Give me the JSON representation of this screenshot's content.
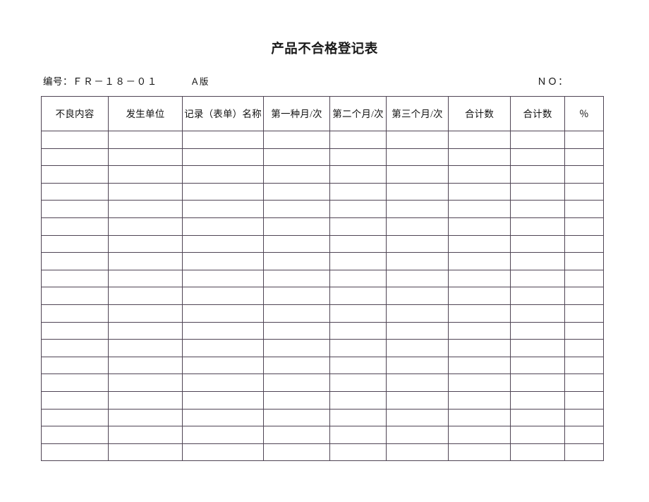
{
  "document": {
    "title": "产品不合格登记表",
    "meta": {
      "code_label": "编号：",
      "code_value": "ＦＲ－１８－０１",
      "edition": "Ａ版",
      "no_label": "ＮＯ："
    }
  },
  "table": {
    "headers": [
      "不良内容",
      "发生单位",
      "记录（表单）名称",
      "第一种月/次",
      "第二个月/次",
      "第三个月/次",
      "合计数",
      "合计数",
      "％"
    ],
    "row_count": 19,
    "rows": [
      [
        "",
        "",
        "",
        "",
        "",
        "",
        "",
        "",
        ""
      ],
      [
        "",
        "",
        "",
        "",
        "",
        "",
        "",
        "",
        ""
      ],
      [
        "",
        "",
        "",
        "",
        "",
        "",
        "",
        "",
        ""
      ],
      [
        "",
        "",
        "",
        "",
        "",
        "",
        "",
        "",
        ""
      ],
      [
        "",
        "",
        "",
        "",
        "",
        "",
        "",
        "",
        ""
      ],
      [
        "",
        "",
        "",
        "",
        "",
        "",
        "",
        "",
        ""
      ],
      [
        "",
        "",
        "",
        "",
        "",
        "",
        "",
        "",
        ""
      ],
      [
        "",
        "",
        "",
        "",
        "",
        "",
        "",
        "",
        ""
      ],
      [
        "",
        "",
        "",
        "",
        "",
        "",
        "",
        "",
        ""
      ],
      [
        "",
        "",
        "",
        "",
        "",
        "",
        "",
        "",
        ""
      ],
      [
        "",
        "",
        "",
        "",
        "",
        "",
        "",
        "",
        ""
      ],
      [
        "",
        "",
        "",
        "",
        "",
        "",
        "",
        "",
        ""
      ],
      [
        "",
        "",
        "",
        "",
        "",
        "",
        "",
        "",
        ""
      ],
      [
        "",
        "",
        "",
        "",
        "",
        "",
        "",
        "",
        ""
      ],
      [
        "",
        "",
        "",
        "",
        "",
        "",
        "",
        "",
        ""
      ],
      [
        "",
        "",
        "",
        "",
        "",
        "",
        "",
        "",
        ""
      ],
      [
        "",
        "",
        "",
        "",
        "",
        "",
        "",
        "",
        ""
      ],
      [
        "",
        "",
        "",
        "",
        "",
        "",
        "",
        "",
        ""
      ],
      [
        "",
        "",
        "",
        "",
        "",
        "",
        "",
        "",
        ""
      ]
    ]
  },
  "colors": {
    "page_background": "#ffffff",
    "text": "#111111",
    "table_border": "#4f4454"
  }
}
